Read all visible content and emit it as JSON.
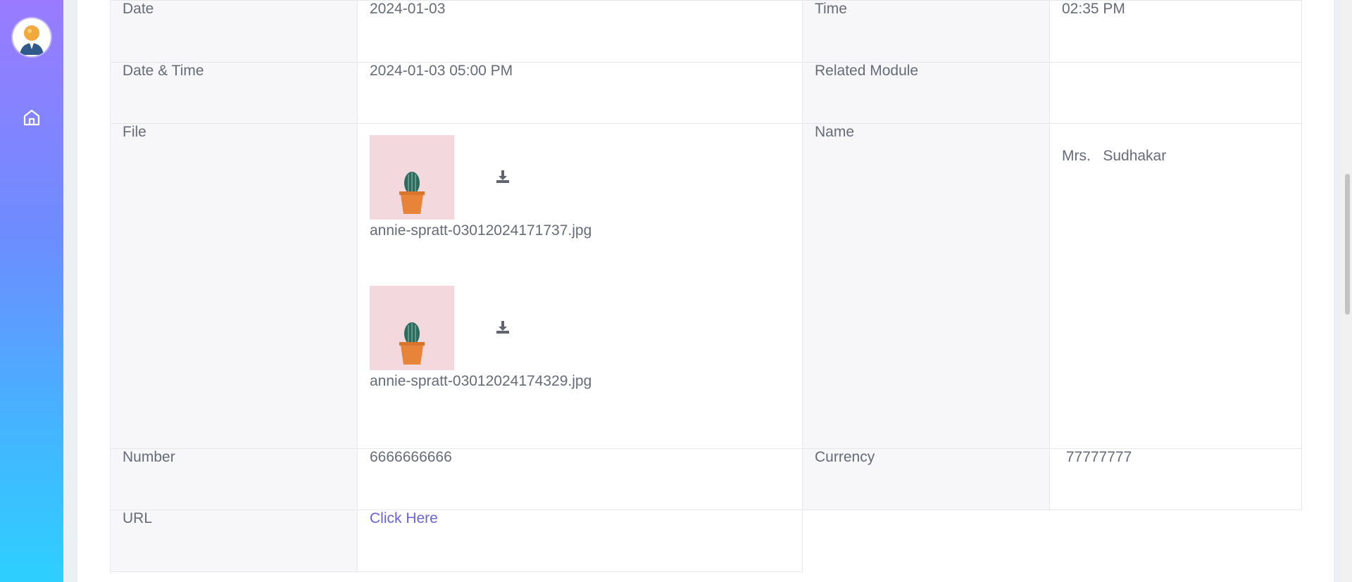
{
  "sidebar": {
    "avatar_icon": "user-avatar-icon",
    "nav_icon": "home-icon"
  },
  "details": {
    "date_label": "Date",
    "date_value": "2024-01-03",
    "time_label": "Time",
    "time_value": "02:35 PM",
    "datetime_label": "Date & Time",
    "datetime_value": "2024-01-03 05:00 PM",
    "related_label": "Related Module",
    "related_value": "",
    "file_label": "File",
    "files": [
      {
        "name": "annie-spratt-03012024171737.jpg",
        "download_icon": "download-icon"
      },
      {
        "name": "annie-spratt-03012024174329.jpg",
        "download_icon": "download-icon"
      }
    ],
    "name_label": "Name",
    "name_value": "Mrs.   Sudhakar",
    "number_label": "Number",
    "number_value": "6666666666",
    "currency_label": "Currency",
    "currency_value": " 77777777",
    "url_label": "URL",
    "url_link_text": "Click Here"
  },
  "colors": {
    "sidebar_gradient_top": "#9a7bff",
    "sidebar_gradient_bottom": "#2dd0ff",
    "link": "#6a64d6",
    "label_bg": "#f7f7f9"
  }
}
